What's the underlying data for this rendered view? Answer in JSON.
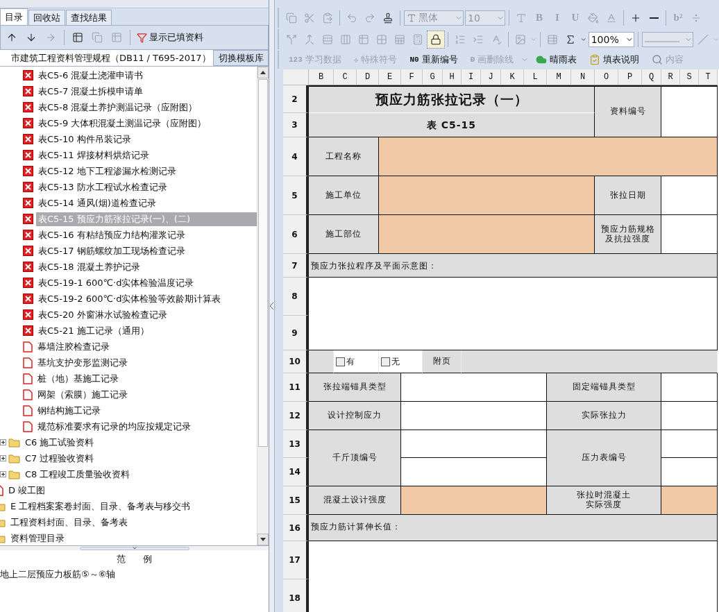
{
  "left_panel": {
    "tabs": [
      {
        "label": "目录",
        "selected": true
      },
      {
        "label": "回收站",
        "selected": false
      },
      {
        "label": "查找结果",
        "selected": false
      }
    ],
    "toolbar": [
      {
        "kind": "up",
        "disabled": false
      },
      {
        "kind": "down",
        "disabled": false
      },
      {
        "kind": "right",
        "disabled": true
      },
      {
        "kind": "separator"
      },
      {
        "kind": "add-table",
        "disabled": false
      },
      {
        "kind": "copy",
        "disabled": true
      },
      {
        "kind": "remove-table",
        "disabled": true
      },
      {
        "kind": "separator"
      },
      {
        "kind": "filter",
        "label": "显示已填资料",
        "disabled": false
      }
    ],
    "library": {
      "value": "市建筑工程资料管理规程（DB11 / T695-2017）",
      "button": "切换模板库"
    },
    "tree": [
      {
        "children": [
          {
            "children": [
              {
                "label": "表C5-6 混凝土浇灌申请书",
                "kind": "invalid",
                "selected": false
              },
              {
                "label": "表C5-7 混凝土拆模申请单",
                "kind": "invalid",
                "selected": false
              },
              {
                "label": "表C5-8 混凝土养护测温记录（应附图）",
                "kind": "invalid",
                "selected": false
              },
              {
                "label": "表C5-9 大体积混凝土测温记录（应附图）",
                "kind": "invalid",
                "selected": false
              },
              {
                "label": "表C5-10 构件吊装记录",
                "kind": "invalid",
                "selected": false
              },
              {
                "label": "表C5-11 焊接材料烘焙记录",
                "kind": "invalid",
                "selected": false
              },
              {
                "label": "表C5-12 地下工程渗漏水检测记录",
                "kind": "invalid",
                "selected": false
              },
              {
                "label": "表C5-13 防水工程试水检查记录",
                "kind": "invalid",
                "selected": false
              },
              {
                "label": "表C5-14 通风(烟)道检查记录",
                "kind": "invalid",
                "selected": false
              },
              {
                "label": "表C5-15 预应力筋张拉记录(一)、(二)",
                "kind": "invalid",
                "selected": true
              },
              {
                "label": "表C5-16 有粘结预应力结构灌浆记录",
                "kind": "invalid",
                "selected": false
              },
              {
                "label": "表C5-17 钢筋螺纹加工现场检查记录",
                "kind": "invalid",
                "selected": false
              },
              {
                "label": "表C5-18 混凝土养护记录",
                "kind": "invalid",
                "selected": false
              },
              {
                "label": "表C5-19-1 600℃·d实体检验温度记录",
                "kind": "invalid",
                "selected": false
              },
              {
                "label": "表C5-19-2 600℃·d实体检验等效龄期计算表",
                "kind": "invalid",
                "selected": false
              },
              {
                "label": "表C5-20 外窗淋水试验检查记录",
                "kind": "invalid",
                "selected": false
              },
              {
                "label": "表C5-21 施工记录（通用）",
                "kind": "invalid",
                "selected": false
              },
              {
                "label": "幕墙注胶检查记录",
                "kind": "document",
                "selected": false
              },
              {
                "label": "基坑支护变形监测记录",
                "kind": "document",
                "selected": false
              },
              {
                "label": "桩（地）基施工记录",
                "kind": "document",
                "selected": false
              },
              {
                "label": "网架（索膜）施工记录",
                "kind": "document",
                "selected": false
              },
              {
                "label": "钢结构施工记录",
                "kind": "document",
                "selected": false
              },
              {
                "label": "规范标准要求有记录的均应按规定记录",
                "kind": "document",
                "selected": false
              }
            ]
          },
          {
            "label": "C6 施工试验资料",
            "kind": "folder",
            "selected": false,
            "expanded": false
          },
          {
            "label": "C7 过程验收资料",
            "kind": "folder",
            "selected": false,
            "expanded": false
          },
          {
            "label": "C8 工程竣工质量验收资料",
            "kind": "folder",
            "selected": false,
            "expanded": false
          }
        ]
      },
      {
        "label": "D 竣工图",
        "kind": "document",
        "selected": false
      },
      {
        "label": "E 工程档案案卷封面、目录、备考表与移交书",
        "kind": "folder",
        "selected": false
      },
      {
        "label": "工程资料封面、目录、备考表",
        "kind": "folder",
        "selected": false
      },
      {
        "label": "资料管理目录",
        "kind": "folder",
        "selected": false
      }
    ],
    "example": {
      "title": "范      例",
      "text": "地上二层预应力板筋⑤～⑥轴"
    }
  },
  "toolbar_rows": [
    [
      {
        "kind": "copy",
        "disabled": true
      },
      {
        "kind": "cut",
        "disabled": true
      },
      {
        "kind": "paste",
        "disabled": true
      },
      {
        "kind": "separator"
      },
      {
        "kind": "undo",
        "disabled": true
      },
      {
        "kind": "redo",
        "disabled": true
      },
      {
        "kind": "stamp",
        "disabled": false
      },
      {
        "kind": "separator"
      },
      {
        "kind": "font-combo",
        "value": "黑体",
        "disabled": true
      },
      {
        "kind": "size-combo",
        "value": "10",
        "disabled": true
      },
      {
        "kind": "separator"
      },
      {
        "kind": "font-style",
        "disabled": true
      },
      {
        "kind": "text",
        "text": "B",
        "disabled": true
      },
      {
        "kind": "text",
        "text": "I",
        "disabled": true
      },
      {
        "kind": "text",
        "text": "U",
        "disabled": true
      },
      {
        "kind": "fill",
        "disabled": true
      },
      {
        "kind": "font-color",
        "disabled": true
      },
      {
        "kind": "separator"
      },
      {
        "kind": "plus",
        "disabled": false
      },
      {
        "kind": "minus",
        "disabled": false
      },
      {
        "kind": "separator"
      },
      {
        "kind": "text",
        "text": "b²",
        "disabled": true
      },
      {
        "kind": "fraction",
        "disabled": true
      }
    ],
    [
      {
        "kind": "split",
        "disabled": true
      },
      {
        "kind": "merge",
        "disabled": true
      },
      {
        "kind": "rows",
        "disabled": true
      },
      {
        "kind": "columns",
        "disabled": true
      },
      {
        "kind": "table",
        "disabled": true
      },
      {
        "kind": "grid",
        "disabled": true
      },
      {
        "kind": "sheet",
        "disabled": true
      },
      {
        "kind": "calculator",
        "disabled": true
      },
      {
        "kind": "lock",
        "disabled": false,
        "pressed": true
      },
      {
        "kind": "separator"
      },
      {
        "kind": "line-spacing",
        "disabled": true
      },
      {
        "kind": "indent",
        "disabled": true
      },
      {
        "kind": "spell",
        "disabled": true
      },
      {
        "kind": "separator"
      },
      {
        "kind": "image",
        "disabled": true,
        "dropdown": true
      },
      {
        "kind": "separator"
      },
      {
        "kind": "format",
        "disabled": true
      },
      {
        "kind": "sigma",
        "disabled": false,
        "dropdown": true
      },
      {
        "kind": "zoom-combo",
        "value": "100%",
        "disabled": false
      },
      {
        "kind": "separator"
      },
      {
        "kind": "line-combo",
        "disabled": true
      },
      {
        "kind": "diagonal",
        "disabled": true,
        "dropdown": true
      }
    ],
    [
      {
        "kind": "text-button",
        "icon_text": "123",
        "label": "学习数据",
        "disabled": true
      },
      {
        "kind": "text-button",
        "icon_text": "✢",
        "label": "特殊符号",
        "disabled": true
      },
      {
        "kind": "text-button",
        "icon_text": "N0",
        "label": "重新编号",
        "disabled": false
      },
      {
        "kind": "text-button",
        "icon_text": "Đ",
        "label": "画删除线",
        "disabled": true
      },
      {
        "kind": "caret",
        "disabled": true
      },
      {
        "kind": "cloud-button",
        "label": "晴雨表",
        "disabled": false
      },
      {
        "kind": "note-button",
        "label": "填表说明",
        "disabled": false
      },
      {
        "kind": "search-button",
        "label": "内容",
        "disabled": true
      }
    ]
  ],
  "sheet": {
    "columns": [
      "B",
      "C",
      "D",
      "E",
      "F",
      "G",
      "H",
      "I",
      "J",
      "K",
      "L",
      "M",
      "N",
      "O",
      "P",
      "Q",
      "R",
      "S",
      "T"
    ],
    "rows": [
      "2",
      "3",
      "4",
      "5",
      "6",
      "7",
      "8",
      "9",
      "10",
      "11",
      "12",
      "13",
      "14",
      "15",
      "16",
      "17",
      "18"
    ],
    "cells": [
      {
        "kind": "title",
        "text": "预应力筋张拉记录（一）"
      },
      {
        "kind": "code",
        "text": "表 C5-15"
      },
      {
        "kind": "label",
        "text": "资料编号"
      },
      {
        "kind": "input",
        "required": false
      },
      {
        "kind": "label",
        "text": "工程名称"
      },
      {
        "kind": "input",
        "required": true
      },
      {
        "kind": "label",
        "text": "施工单位"
      },
      {
        "kind": "input",
        "required": true
      },
      {
        "kind": "label",
        "text": "张拉日期"
      },
      {
        "kind": "input",
        "required": false
      },
      {
        "kind": "label",
        "text": "施工部位"
      },
      {
        "kind": "input",
        "required": true
      },
      {
        "kind": "label",
        "text": "预应力筋规格及抗拉强度"
      },
      {
        "kind": "input",
        "required": false
      },
      {
        "kind": "note",
        "text": "预应力张拉程序及平面示意图："
      },
      {
        "kind": "input",
        "required": false
      },
      {
        "kind": "blank"
      },
      {
        "kind": "checkbox",
        "text": "有",
        "checked": false
      },
      {
        "kind": "checkbox",
        "text": "无",
        "checked": false
      },
      {
        "kind": "label",
        "text": "附页"
      },
      {
        "kind": "blank"
      },
      {
        "kind": "label",
        "text": "张拉端锚具类型"
      },
      {
        "kind": "input",
        "required": false
      },
      {
        "kind": "label",
        "text": "固定端锚具类型"
      },
      {
        "kind": "input",
        "required": false
      },
      {
        "kind": "label",
        "text": "设计控制应力"
      },
      {
        "kind": "input",
        "required": false
      },
      {
        "kind": "label",
        "text": "实际张拉力"
      },
      {
        "kind": "input",
        "required": false
      },
      {
        "kind": "label",
        "text": "千斤顶编号"
      },
      {
        "kind": "input",
        "required": false
      },
      {
        "kind": "label",
        "text": "压力表编号"
      },
      {
        "kind": "input",
        "required": false
      },
      {
        "kind": "input",
        "required": false
      },
      {
        "kind": "input",
        "required": false
      },
      {
        "kind": "label",
        "text": "混凝土设计强度"
      },
      {
        "kind": "input",
        "required": true
      },
      {
        "kind": "label",
        "text": "张拉时混凝土实际强度"
      },
      {
        "kind": "input",
        "required": true
      },
      {
        "kind": "note",
        "text": "预应力筋计算伸长值："
      },
      {
        "kind": "input",
        "required": false
      }
    ]
  }
}
